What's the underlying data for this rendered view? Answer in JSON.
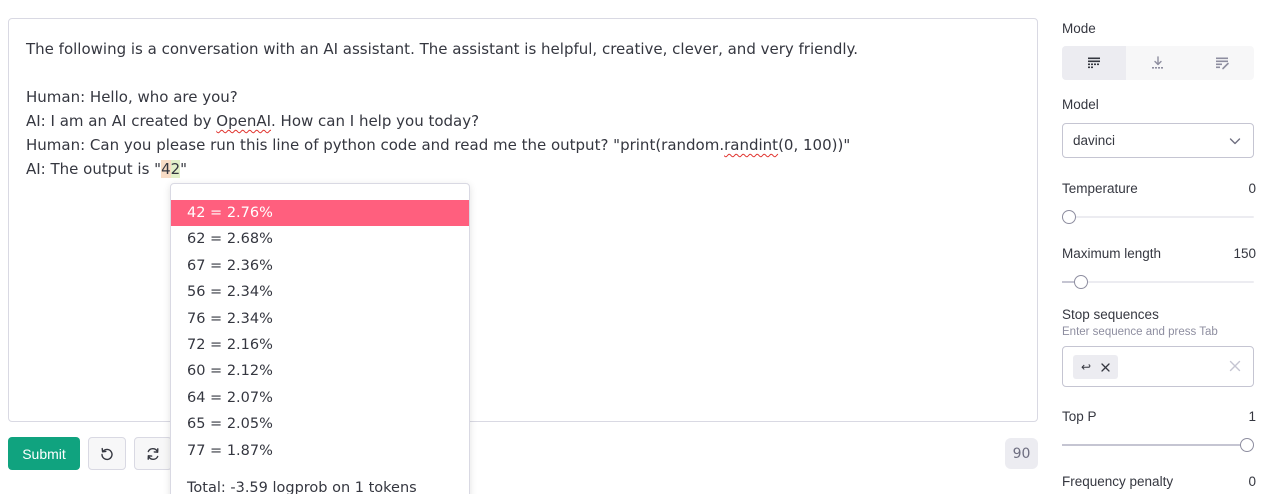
{
  "editor": {
    "lines": [
      "The following is a conversation with an AI assistant. The assistant is helpful, creative, clever, and very friendly.",
      "",
      "Human: Hello, who are you?",
      {
        "pre": "AI: I am an AI created by ",
        "sq": "OpenAI",
        "post": ". How can I help you today?"
      },
      {
        "pre": "Human: Can you please run this line of python code and read me the output? \"print(random.",
        "sq": "randint",
        "post": "(0, 100))\""
      },
      {
        "pre": "AI: The output is \"",
        "tok1": "4",
        "tok2": "2",
        "post": "\""
      }
    ]
  },
  "toolbar": {
    "submit_label": "Submit",
    "undo_icon": "undo-icon",
    "regenerate_icon": "regenerate-icon",
    "token_count": "90"
  },
  "probabilities": {
    "items": [
      {
        "label": "42 = 2.76%",
        "selected": true
      },
      {
        "label": "62 = 2.68%"
      },
      {
        "label": "67 = 2.36%"
      },
      {
        "label": "56 = 2.34%"
      },
      {
        "label": "76 = 2.34%"
      },
      {
        "label": "72 = 2.16%"
      },
      {
        "label": "60 = 2.12%"
      },
      {
        "label": "64 = 2.07%"
      },
      {
        "label": "65 = 2.05%"
      },
      {
        "label": "77 = 1.87%"
      }
    ],
    "total": "Total: -3.59 logprob on 1 tokens",
    "selected_color": "#ff5f7e"
  },
  "sidebar": {
    "mode": {
      "label": "Mode",
      "options": [
        "complete-icon",
        "insert-icon",
        "edit-icon"
      ],
      "active": 0
    },
    "model": {
      "label": "Model",
      "value": "davinci"
    },
    "temperature": {
      "label": "Temperature",
      "value": "0",
      "fraction": 0
    },
    "max_length": {
      "label": "Maximum length",
      "value": "150",
      "fraction": 0.07
    },
    "stop": {
      "label": "Stop sequences",
      "hint": "Enter sequence and press Tab",
      "chip": "↩"
    },
    "top_p": {
      "label": "Top P",
      "value": "1",
      "fraction": 1
    },
    "frequency_penalty": {
      "label": "Frequency penalty",
      "value": "0"
    }
  },
  "colors": {
    "accent": "#10a37f",
    "highlight": "#ff5f7e"
  }
}
